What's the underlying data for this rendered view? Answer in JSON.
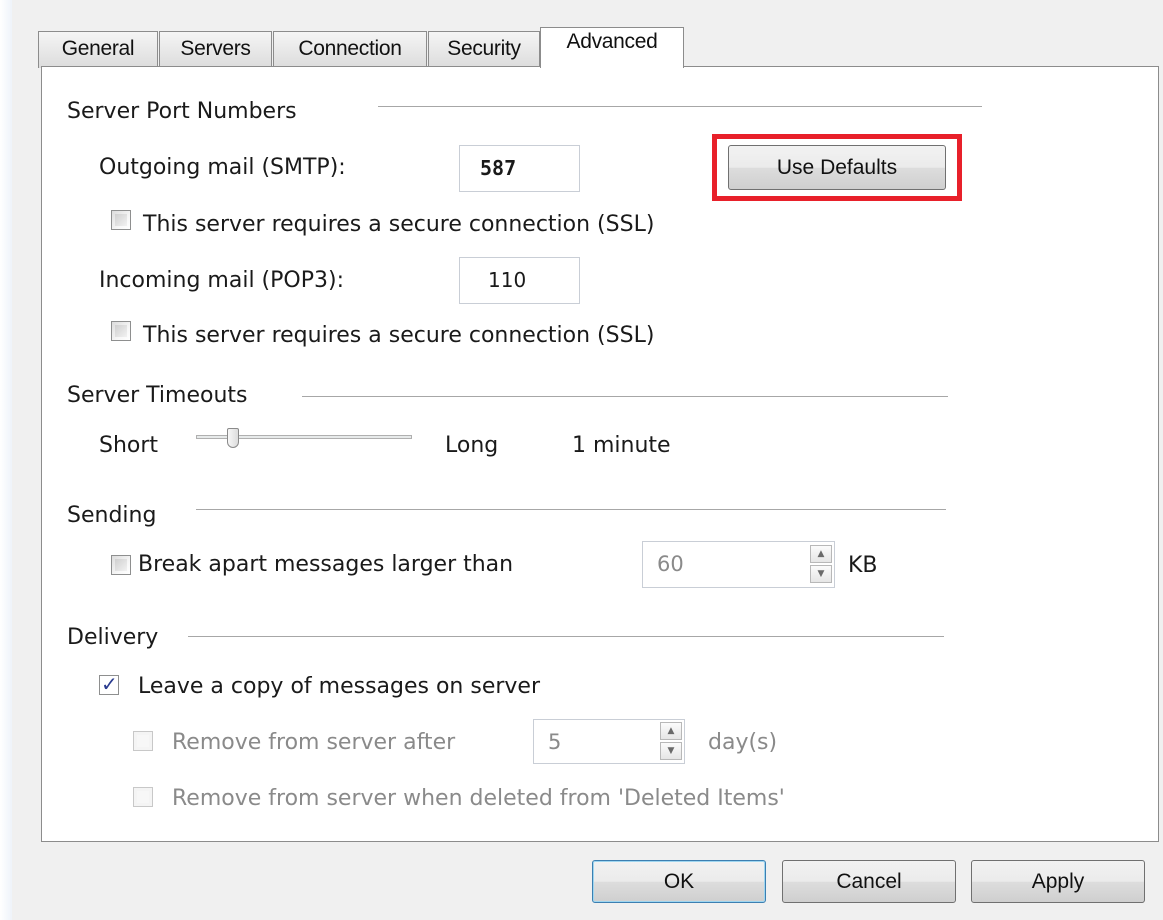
{
  "tabs": [
    {
      "label": "General"
    },
    {
      "label": "Servers"
    },
    {
      "label": "Connection"
    },
    {
      "label": "Security"
    },
    {
      "label": "Advanced",
      "active": true
    }
  ],
  "server_ports": {
    "heading": "Server Port Numbers",
    "outgoing_label": "Outgoing mail (SMTP):",
    "outgoing_value": "587",
    "use_defaults": "Use Defaults",
    "outgoing_ssl_label": "This server requires a secure connection (SSL)",
    "outgoing_ssl_checked": false,
    "incoming_label": "Incoming mail (POP3):",
    "incoming_value": "110",
    "incoming_ssl_label": "This server requires a secure connection (SSL)",
    "incoming_ssl_checked": false
  },
  "timeouts": {
    "heading": "Server Timeouts",
    "short_label": "Short",
    "long_label": "Long",
    "value_text": "1 minute",
    "slider_level": 0.15
  },
  "sending": {
    "heading": "Sending",
    "break_apart_label": "Break apart messages larger than",
    "break_apart_checked": false,
    "size_value": "60",
    "size_unit": "KB"
  },
  "delivery": {
    "heading": "Delivery",
    "leave_copy_label": "Leave a copy of messages on server",
    "leave_copy_checked": true,
    "remove_after_label": "Remove from server after",
    "remove_after_checked": false,
    "days_value": "5",
    "days_unit": "day(s)",
    "remove_deleted_label": "Remove from server when deleted from 'Deleted Items'",
    "remove_deleted_checked": false
  },
  "footer": {
    "ok": "OK",
    "cancel": "Cancel",
    "apply": "Apply"
  },
  "colors": {
    "highlight": "#e8202a",
    "accent": "#2a3b8f"
  }
}
